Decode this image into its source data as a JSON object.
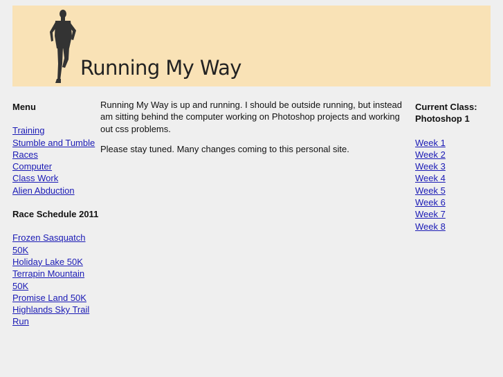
{
  "header": {
    "title": "Running My Way"
  },
  "sidebar": {
    "menu_heading": "Menu",
    "menu": [
      "Training",
      "Stumble and Tumble",
      "Races",
      "Computer",
      "Class Work",
      "Alien Abduction"
    ],
    "race_heading": "Race Schedule 2011",
    "races": [
      "Frozen Sasquatch 50K",
      "Holiday Lake 50K",
      "Terrapin Mountain 50K",
      "Promise Land 50K",
      "Highlands Sky Trail Run"
    ]
  },
  "main": {
    "paragraphs": [
      "Running My Way is up and running. I should be outside running, but instead am sitting behind the computer working on Photoshop projects and working out css problems.",
      "Please stay tuned. Many changes coming to this personal site."
    ]
  },
  "right": {
    "heading": "Current Class: Photoshop 1",
    "weeks": [
      "Week 1",
      "Week 2",
      "Week 3",
      "Week 4",
      "Week 5",
      "Week 6",
      "Week 7",
      "Week 8"
    ]
  },
  "colors": {
    "banner": "#f9e2b6",
    "link": "#1a1ab5",
    "background": "#efefef"
  }
}
